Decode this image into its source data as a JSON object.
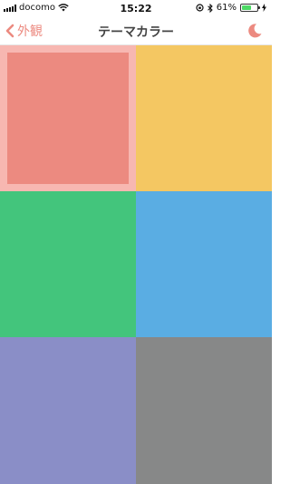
{
  "status_bar": {
    "carrier": "docomo",
    "time": "15:22",
    "battery_percent": "61%",
    "battery_level": 0.61
  },
  "nav": {
    "back_label": "外観",
    "title": "テーマカラー",
    "accent": "#ec8a80"
  },
  "swatches": [
    {
      "name": "pink",
      "color": "#ec8a80",
      "selected": true,
      "frame": "#f7b7b1"
    },
    {
      "name": "yellow",
      "color": "#f4c762",
      "selected": false
    },
    {
      "name": "green",
      "color": "#43c57c",
      "selected": false
    },
    {
      "name": "blue",
      "color": "#5aade3",
      "selected": false
    },
    {
      "name": "purple",
      "color": "#8a8ec7",
      "selected": false
    },
    {
      "name": "gray",
      "color": "#878888",
      "selected": false
    }
  ]
}
